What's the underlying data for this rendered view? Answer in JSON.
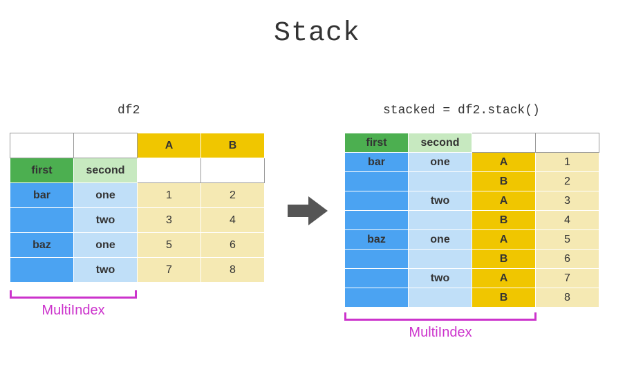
{
  "title": "Stack",
  "captions": {
    "left": "df2",
    "right": "stacked = df2.stack()"
  },
  "df2": {
    "col_headers": {
      "A": "A",
      "B": "B"
    },
    "index_names": {
      "first": "first",
      "second": "second"
    },
    "rows": [
      {
        "first": "bar",
        "second": "one",
        "A": "1",
        "B": "2"
      },
      {
        "first": "",
        "second": "two",
        "A": "3",
        "B": "4"
      },
      {
        "first": "baz",
        "second": "one",
        "A": "5",
        "B": "6"
      },
      {
        "first": "",
        "second": "two",
        "A": "7",
        "B": "8"
      }
    ]
  },
  "stacked": {
    "index_names": {
      "first": "first",
      "second": "second"
    },
    "rows": [
      {
        "first": "bar",
        "second": "one",
        "col": "A",
        "val": "1"
      },
      {
        "first": "",
        "second": "",
        "col": "B",
        "val": "2"
      },
      {
        "first": "",
        "second": "two",
        "col": "A",
        "val": "3"
      },
      {
        "first": "",
        "second": "",
        "col": "B",
        "val": "4"
      },
      {
        "first": "baz",
        "second": "one",
        "col": "A",
        "val": "5"
      },
      {
        "first": "",
        "second": "",
        "col": "B",
        "val": "6"
      },
      {
        "first": "",
        "second": "two",
        "col": "A",
        "val": "7"
      },
      {
        "first": "",
        "second": "",
        "col": "B",
        "val": "8"
      }
    ]
  },
  "multiindex_label": "MultiIndex"
}
